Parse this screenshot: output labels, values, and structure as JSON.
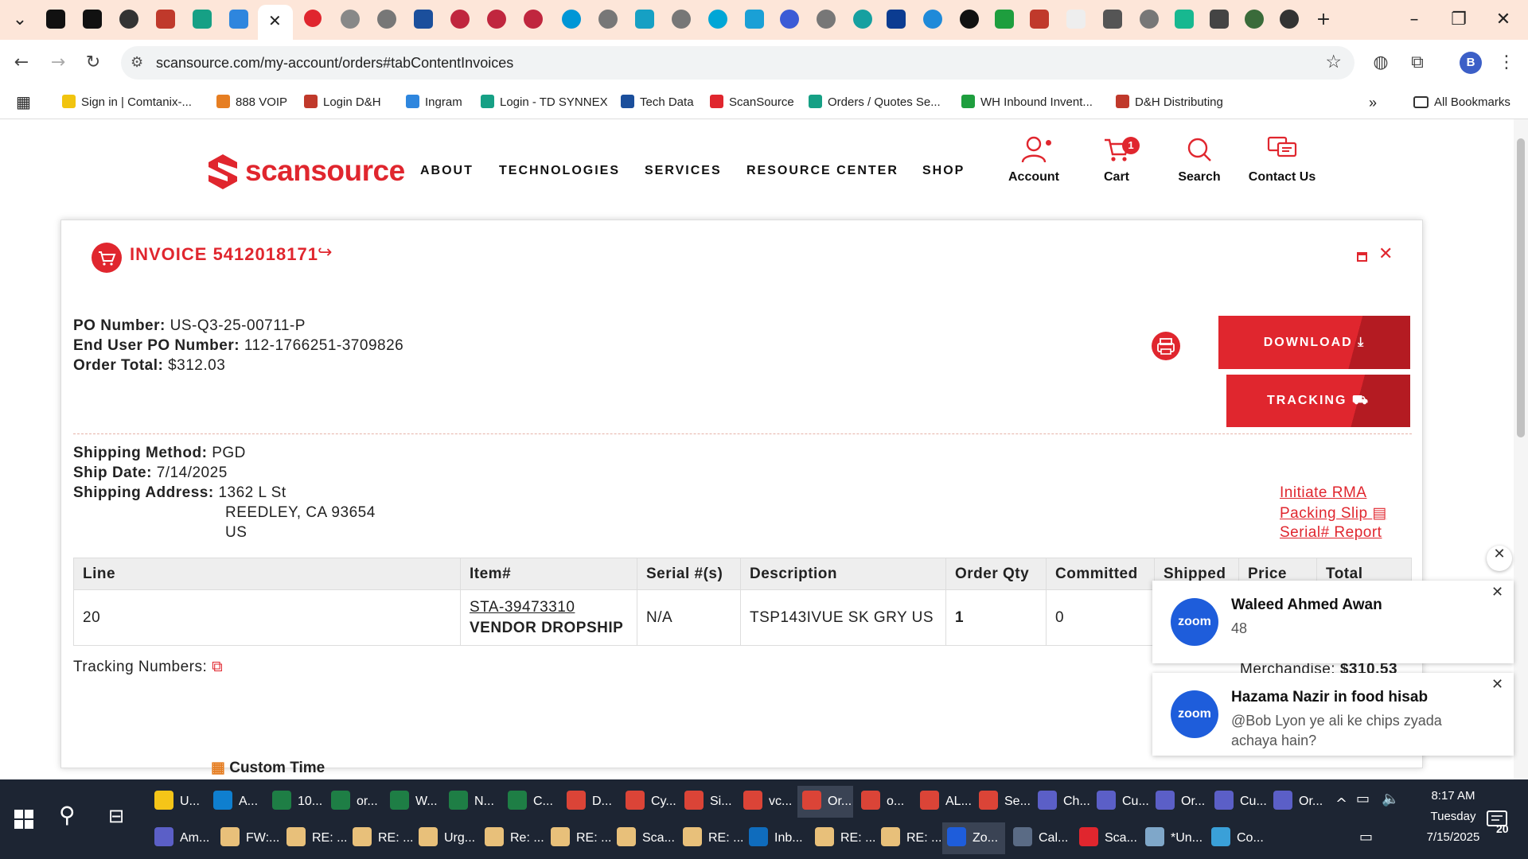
{
  "browser": {
    "url": "scansource.com/my-account/orders#tabContentInvoices",
    "profile_initial": "B",
    "bookmarks": [
      {
        "label": "Sign in | Comtanix-...",
        "color": "#f1c40f"
      },
      {
        "label": "888 VOIP",
        "color": "#e67e22"
      },
      {
        "label": "Login D&H",
        "color": "#c0392b"
      },
      {
        "label": "Ingram",
        "color": "#2e86de"
      },
      {
        "label": "Login - TD SYNNEX",
        "color": "#16a085"
      },
      {
        "label": "Tech Data",
        "color": "#1b4f9c"
      },
      {
        "label": "ScanSource",
        "color": "#e0262e"
      },
      {
        "label": "Orders / Quotes Se...",
        "color": "#16a085"
      },
      {
        "label": "WH Inbound Invent...",
        "color": "#1e9e3e"
      },
      {
        "label": "D&H Distributing",
        "color": "#c0392b"
      }
    ],
    "all_bookmarks": "All Bookmarks"
  },
  "site": {
    "logo_text": "scansource",
    "nav": [
      "ABOUT",
      "TECHNOLOGIES",
      "SERVICES",
      "RESOURCE CENTER",
      "SHOP"
    ],
    "utility": {
      "account": "Account",
      "cart": "Cart",
      "cart_count": "1",
      "search": "Search",
      "contact": "Contact Us"
    }
  },
  "invoice": {
    "title": "INVOICE 5412018171",
    "po_label": "PO Number:",
    "po_value": "US-Q3-25-00711-P",
    "enduser_po_label": "End User PO Number:",
    "enduser_po_value": "112-1766251-3709826",
    "total_label": "Order Total:",
    "total_value": "$312.03",
    "download_label": "DOWNLOAD",
    "tracking_label": "TRACKING",
    "ship_method_label": "Shipping Method:",
    "ship_method_value": "PGD",
    "ship_date_label": "Ship Date:",
    "ship_date_value": "7/14/2025",
    "ship_addr_label": "Shipping Address:",
    "addr_line1": "1362 L St",
    "addr_line2": "REEDLEY, CA 93654",
    "addr_line3": "US",
    "links": {
      "rma": "Initiate RMA",
      "packing": "Packing Slip",
      "serial": "Serial# Report"
    },
    "table": {
      "headers": [
        "Line",
        "Item#",
        "Serial #(s)",
        "Description",
        "Order Qty",
        "Committed",
        "Shipped",
        "Price",
        "Total"
      ],
      "row": {
        "line": "20",
        "item": "STA-39473310",
        "item_sub": "VENDOR DROPSHIP",
        "serial": "N/A",
        "description": "TSP143IVUE SK GRY US",
        "qty": "1",
        "committed": "0"
      }
    },
    "tracking_numbers_label": "Tracking Numbers:",
    "merch_label": "Merchandise:",
    "merch_value": "$310.53",
    "custom_time": "Custom Time"
  },
  "notifications": [
    {
      "app": "zoom",
      "title": "Waleed Ahmed Awan",
      "message": "48"
    },
    {
      "app": "zoom",
      "title": "Hazama Nazir in food hisab",
      "message": "@Bob Lyon ye ali ke chips zyada achaya hain?"
    }
  ],
  "taskbar": {
    "row1": [
      {
        "label": "U...",
        "color": "#f5c518"
      },
      {
        "label": "A...",
        "color": "#0f7fcf"
      },
      {
        "label": "10...",
        "color": "#1e7e45"
      },
      {
        "label": "or...",
        "color": "#1e7e45"
      },
      {
        "label": "W...",
        "color": "#1e7e45"
      },
      {
        "label": "N...",
        "color": "#1e7e45"
      },
      {
        "label": "C...",
        "color": "#1e7e45"
      },
      {
        "label": "D...",
        "color": "#db4437"
      },
      {
        "label": "Cy...",
        "color": "#db4437"
      },
      {
        "label": "Si...",
        "color": "#db4437"
      },
      {
        "label": "vc...",
        "color": "#db4437"
      },
      {
        "label": "Or...",
        "color": "#db4437"
      },
      {
        "label": "o...",
        "color": "#db4437"
      },
      {
        "label": "AL...",
        "color": "#db4437"
      },
      {
        "label": "Se...",
        "color": "#db4437"
      },
      {
        "label": "Ch...",
        "color": "#5b5fc7"
      },
      {
        "label": "Cu...",
        "color": "#5b5fc7"
      },
      {
        "label": "Or...",
        "color": "#5b5fc7"
      },
      {
        "label": "Cu...",
        "color": "#5b5fc7"
      },
      {
        "label": "Or...",
        "color": "#5b5fc7"
      }
    ],
    "row2": [
      {
        "label": "Am...",
        "color": "#5b5fc7"
      },
      {
        "label": "FW:...",
        "color": "#e8c07a"
      },
      {
        "label": "RE: ...",
        "color": "#e8c07a"
      },
      {
        "label": "RE: ...",
        "color": "#e8c07a"
      },
      {
        "label": "Urg...",
        "color": "#e8c07a"
      },
      {
        "label": "Re: ...",
        "color": "#e8c07a"
      },
      {
        "label": "RE: ...",
        "color": "#e8c07a"
      },
      {
        "label": "Sca...",
        "color": "#e8c07a"
      },
      {
        "label": "RE: ...",
        "color": "#e8c07a"
      },
      {
        "label": "Inb...",
        "color": "#0f6cbd"
      },
      {
        "label": "RE: ...",
        "color": "#e8c07a"
      },
      {
        "label": "RE: ...",
        "color": "#e8c07a"
      },
      {
        "label": "Zo...",
        "color": "#1e5ddb"
      },
      {
        "label": "Cal...",
        "color": "#5a6b85"
      },
      {
        "label": "Sca...",
        "color": "#e0262e"
      },
      {
        "label": "*Un...",
        "color": "#7fa7c9"
      },
      {
        "label": "Co...",
        "color": "#3aa0d8"
      }
    ],
    "time": "8:17 AM",
    "day": "Tuesday",
    "date": "7/15/2025",
    "notif_count": "20"
  }
}
